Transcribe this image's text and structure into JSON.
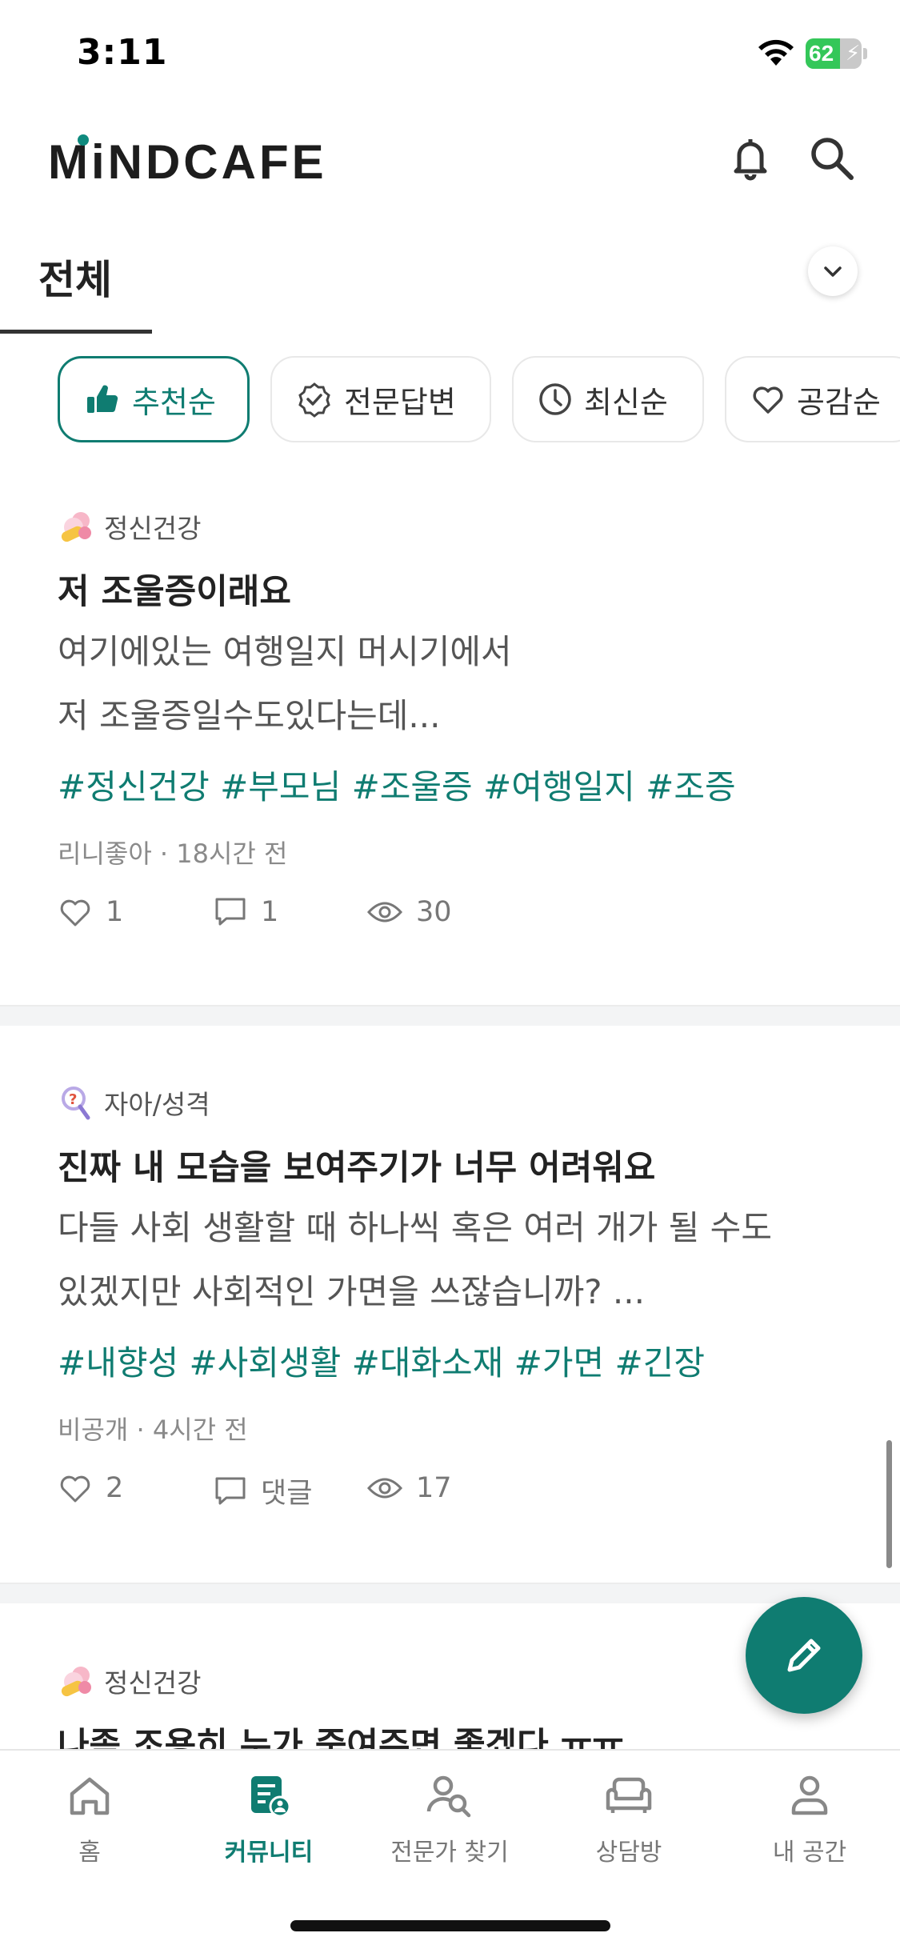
{
  "status_bar": {
    "time": "3:11",
    "battery": "62",
    "battery_level": 0.62
  },
  "header": {
    "logo": "MiNDCAFE"
  },
  "category": {
    "label": "전체"
  },
  "filters": [
    {
      "label": "추천순",
      "icon": "thumbs-up-icon",
      "active": true
    },
    {
      "label": "전문답변",
      "icon": "verified-badge-icon",
      "active": false
    },
    {
      "label": "최신순",
      "icon": "clock-icon",
      "active": false
    },
    {
      "label": "공감순",
      "icon": "heart-icon",
      "active": false
    }
  ],
  "posts": [
    {
      "category": "정신건강",
      "category_icon": "pills-icon",
      "title": "저 조울증이래요",
      "body_line1": "여기에있는 여행일지 머시기에서",
      "body_line2": "저 조울증일수도있다는데...",
      "tags": "#정신건강 #부모님 #조울증 #여행일지 #조증",
      "meta": "리니좋아 · 18시간 전",
      "likes": "1",
      "comments": "1",
      "views": "30"
    },
    {
      "category": "자아/성격",
      "category_icon": "magnifier-question-icon",
      "title": "진짜 내 모습을 보여주기가 너무 어려워요",
      "body_line1": "다들 사회 생활할 때 하나씩 혹은 여러 개가 될 수도",
      "body_line2": "있겠지만 사회적인 가면을 쓰잖습니까? ...",
      "tags": "#내향성 #사회생활 #대화소재 #가면 #긴장",
      "meta": "비공개 · 4시간 전",
      "likes": "2",
      "comments": "댓글",
      "views": "17"
    },
    {
      "category": "정신건강",
      "category_icon": "pills-icon",
      "title": "나좀 조용히 누가 죽여주면 좋겠다 ㅠㅠ"
    }
  ],
  "nav": [
    {
      "label": "홈",
      "icon": "home-icon",
      "active": false
    },
    {
      "label": "커뮤니티",
      "icon": "community-icon",
      "active": true
    },
    {
      "label": "전문가 찾기",
      "icon": "find-expert-icon",
      "active": false
    },
    {
      "label": "상담방",
      "icon": "sofa-icon",
      "active": false
    },
    {
      "label": "내 공간",
      "icon": "person-icon",
      "active": false
    }
  ],
  "colors": {
    "accent": "#0f7c71",
    "text": "#222222",
    "muted": "#8a8a8a"
  }
}
